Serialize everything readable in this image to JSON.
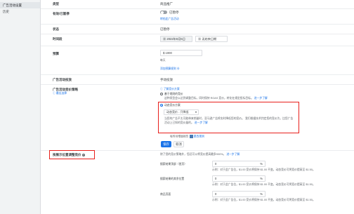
{
  "sidebar": {
    "items": [
      {
        "label": "广告活动设置"
      },
      {
        "label": "历史"
      }
    ]
  },
  "fields": {
    "type": {
      "label": "类型",
      "value": "商品推广"
    },
    "onoff": {
      "label": "有效/已暂停",
      "value": "已暂停",
      "link": "转档此广告活动"
    },
    "status": {
      "label": "状态",
      "value": "已暂停"
    },
    "timerange": {
      "label": "时间段",
      "start": "2022年8月5日",
      "end": "无结束日期"
    },
    "budget": {
      "label": "预算",
      "value": "$ 1000",
      "period": "每天",
      "link": "添加预算规则 ⊕"
    },
    "targeting": {
      "label": "广告活动投放",
      "value": "手动投放"
    },
    "bidding": {
      "label": "广告活动竞价策略",
      "sublink": "ⓘ 最佳选择",
      "opt1": "ⓘ 了解竞价方案",
      "opt2_title": "基于规则的竞价",
      "opt2_desc": "这种类型会以达到调整目标，同时保持 ROAS 竞价，转化在规定投标目标。",
      "opt2_link": "进一步了解",
      "opt3_title": "动态竞价方案",
      "select_label": "动态竞价 - 只降低",
      "select_desc": "当您的广告不太可能带来销量时，亚马逊广告将实时降低您的竞价。 我们根据技术判定您的竞价为，比您广告活动上已知的竞价量的。",
      "select_link": "进一步了解",
      "extra": "每时间增量报告",
      "extra_link": "更改规则"
    },
    "save": "保存",
    "cancel": "取消",
    "placement": {
      "label": "按展示位置调整竞价",
      "desc": "除了您的竞价策略外，您还可以将竞价提高最多900%。",
      "desc_link": "进一步了解",
      "rows": [
        {
          "name": "搜索结果顶部（首页）",
          "value": "0",
          "unit": "%",
          "hint": "示例：对于此广告位，$1.00 竞价将保持 $1.00 不变。动态竞价可将竞价提高至 $1.50。"
        },
        {
          "name": "搜索结果的其余位置",
          "value": "0",
          "unit": "%",
          "hint": "示例：对于此广告位，$1.00 竞价将保持 $1.00 不变。动态竞价可将竞价提高至 $1.50。"
        },
        {
          "name": "商品页面",
          "value": "0",
          "unit": "%",
          "hint": "示例：对于此广告位，$1.00 竞价将保持 $1.00 不变。动态竞价可将竞价提高至 $1.50。"
        }
      ]
    }
  },
  "colors": {
    "accent": "#1a73e8",
    "highlight": "#e8201c"
  }
}
